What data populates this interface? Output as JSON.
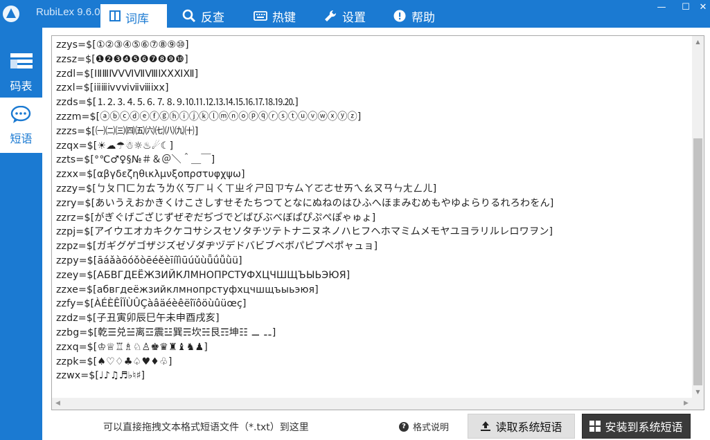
{
  "app": {
    "title": "RubiLex 9.6.0",
    "colors": {
      "primary": "#1b7ad2",
      "install_button": "#3a3a3a"
    }
  },
  "nav": {
    "tabs": [
      {
        "label": "词库",
        "icon": "book-icon",
        "active": true
      },
      {
        "label": "反查",
        "icon": "search-icon"
      },
      {
        "label": "热键",
        "icon": "keyboard-icon"
      },
      {
        "label": "设置",
        "icon": "wrench-icon"
      },
      {
        "label": "帮助",
        "icon": "help-circle-icon"
      }
    ]
  },
  "window_controls": {
    "minimize": "—",
    "maximize": "☐",
    "close": "✕"
  },
  "sidebar": {
    "items": [
      {
        "label": "码表",
        "icon": "table-icon"
      },
      {
        "label": "短语",
        "icon": "chat-bubble-icon",
        "active": true
      }
    ]
  },
  "editor": {
    "lines": [
      "zzys=$[①②③④⑤⑥⑦⑧⑨⑩]",
      "zzsz=$[❶❷❸❹❺❻❼❽❾❿]",
      "zzdl=$[ⅠⅡⅢⅣⅤⅥⅦⅧⅨⅩⅪⅫ]",
      "zzxl=$[ⅰⅱⅲⅳⅴⅵⅶⅷⅸⅹ]",
      "zzds=$[⒈⒉⒊⒋⒌⒍⒎⒏⒐⒑⒒⒓⒔⒕⒖⒗⒘⒙⒚⒛]",
      "zzzm=$[ⓐⓑⓒⓓⓔⓕⓖⓗⓘⓙⓚⓛⓜⓝⓞⓟⓠⓡⓢⓣⓤⓥⓦⓧⓨⓩ]",
      "zzzs=$[㈠㈡㈢㈣㈤㈥㈦㈧㈨㈩]",
      "zzqx=$[☀☁☂☃☼♨☄☾]",
      "zzts=$[°℃♂♀§№＃＆＠＼＾＿￣]",
      "zzxx=$[αβγδεζηθικλμνξοπρστυφχψω]",
      "zzzy=$[ㄅㄆㄇㄈㄉㄊㄋㄌㄍㄎㄏㄐㄑㄒㄓㄔㄕㄖㄗㄘㄙㄚㄛㄜㄝㄞㄟㄠㄡㄢㄣㄤㄥㄦ]",
      "zzry=$[あいうえおかきくけこさしすせそたちつてとなにぬねのはひふへほまみむめもやゆよらりるれろわをん]",
      "zzrz=$[がぎぐげござじずぜぞだぢづでどばびぶべぼぱぴぷぺぽゃゅょ]",
      "zzpj=$[アイウエオカキクケコサシスセソタチツテトナニヌネノハヒフヘホマミムメモヤユヨラリルレロワヲン]",
      "zzpz=$[ガギグゲゴザジズゼゾダヂヅデドバビブベボパピプペポャュョ]",
      "zzpy=$[āáǎàōóǒòēéěèīíǐìūúǔùǖǘǚǜü]",
      "zzey=$[АБВГДЕЁЖЗИЙКЛМНОПРСТУФХЦЧШЩЪЫЬЭЮЯ]",
      "zzxe=$[абвгдеёжзийклмнопрстуфхцчшщъыьэюя]",
      "zzfy=$[ÀÉÈÊÎÏÙÛÇàâäéèêëîïôöùûüœç]",
      "zzdz=$[子丑寅卯辰巳午未申酉戌亥]",
      "zzbg=$[乾☰兑☱离☲震☳巽☴坎☵艮☶坤☷ ⚊ ⚋]",
      "zzxq=$[♔♕♖♗♘♙♚♛♜♝♞♟]",
      "zzpk=$[♠♡♢♣♤♥♦♧]",
      "zzwx=$[♩♪♫♬♭♮♯]"
    ]
  },
  "footer": {
    "drop_hint": "可以直接拖拽文本格式短语文件（*.txt）到这里",
    "format_help": "格式说明",
    "read_button": "读取系统短语",
    "install_button": "安装到系统短语"
  }
}
